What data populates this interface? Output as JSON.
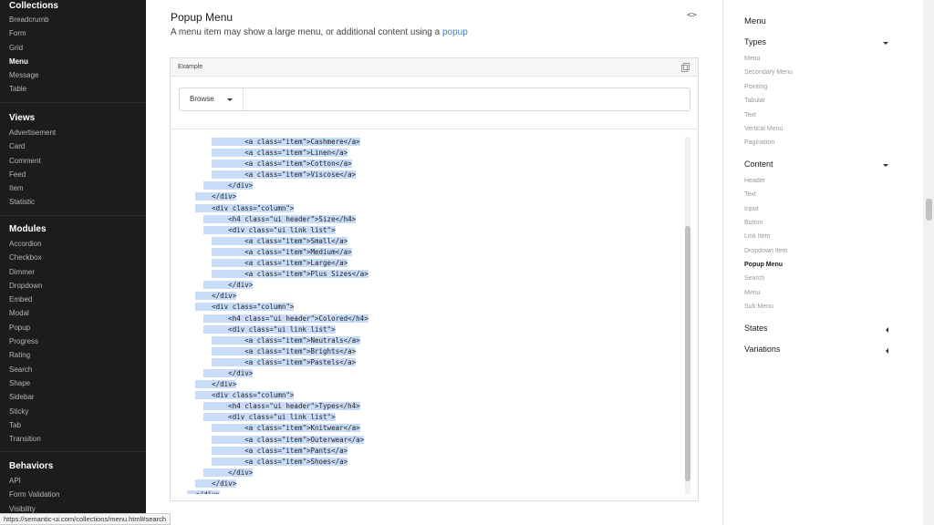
{
  "sidebar": {
    "sections": [
      {
        "title": "Collections",
        "items": [
          "Breadcrumb",
          "Form",
          "Grid",
          "Menu",
          "Message",
          "Table"
        ],
        "active": "Menu"
      },
      {
        "title": "Views",
        "items": [
          "Advertisement",
          "Card",
          "Comment",
          "Feed",
          "Item",
          "Statistic"
        ]
      },
      {
        "title": "Modules",
        "items": [
          "Accordion",
          "Checkbox",
          "Dimmer",
          "Dropdown",
          "Embed",
          "Modal",
          "Popup",
          "Progress",
          "Rating",
          "Search",
          "Shape",
          "Sidebar",
          "Sticky",
          "Tab",
          "Transition"
        ]
      },
      {
        "title": "Behaviors",
        "items": [
          "API",
          "Form Validation",
          "Visibility"
        ]
      }
    ]
  },
  "main": {
    "title": "Popup Menu",
    "description_prefix": "A menu item may show a large menu, or additional content using a ",
    "description_link": "popup",
    "code_toggle": "<>",
    "example_label": "Example",
    "menu_item": "Browse"
  },
  "code_lines": [
    "        <a class=\"item\">Cashmere</a>",
    "        <a class=\"item\">Linen</a>",
    "        <a class=\"item\">Cotton</a>",
    "        <a class=\"item\">Viscose</a>",
    "      </div>",
    "    </div>",
    "    <div class=\"column\">",
    "      <h4 class=\"ui header\">Size</h4>",
    "      <div class=\"ui link list\">",
    "        <a class=\"item\">Small</a>",
    "        <a class=\"item\">Medium</a>",
    "        <a class=\"item\">Large</a>",
    "        <a class=\"item\">Plus Sizes</a>",
    "      </div>",
    "    </div>",
    "    <div class=\"column\">",
    "      <h4 class=\"ui header\">Colored</h4>",
    "      <div class=\"ui link list\">",
    "        <a class=\"item\">Neutrals</a>",
    "        <a class=\"item\">Brights</a>",
    "        <a class=\"item\">Pastels</a>",
    "      </div>",
    "    </div>",
    "    <div class=\"column\">",
    "      <h4 class=\"ui header\">Types</h4>",
    "      <div class=\"ui link list\">",
    "        <a class=\"item\">Knitwear</a>",
    "        <a class=\"item\">Outerwear</a>",
    "        <a class=\"item\">Pants</a>",
    "        <a class=\"item\">Shoes</a>",
    "      </div>",
    "    </div>",
    "  </div>"
  ],
  "rightnav": {
    "title": "Menu",
    "groups": [
      {
        "title": "Types",
        "expanded": true,
        "items": [
          "Menu",
          "Secondary Menu",
          "Pointing",
          "Tabular",
          "Text",
          "Vertical Menu",
          "Pagination"
        ]
      },
      {
        "title": "Content",
        "expanded": true,
        "items": [
          "Header",
          "Text",
          "Input",
          "Button",
          "Link Item",
          "Dropdown Item",
          "Popup Menu",
          "Search",
          "Menu",
          "Sub Menu"
        ],
        "active": "Popup Menu"
      },
      {
        "title": "States",
        "expanded": false,
        "items": []
      },
      {
        "title": "Variations",
        "expanded": false,
        "items": []
      }
    ]
  },
  "statusbar": {
    "url": "https://semantic-ui.com/collections/menu.html#search"
  }
}
